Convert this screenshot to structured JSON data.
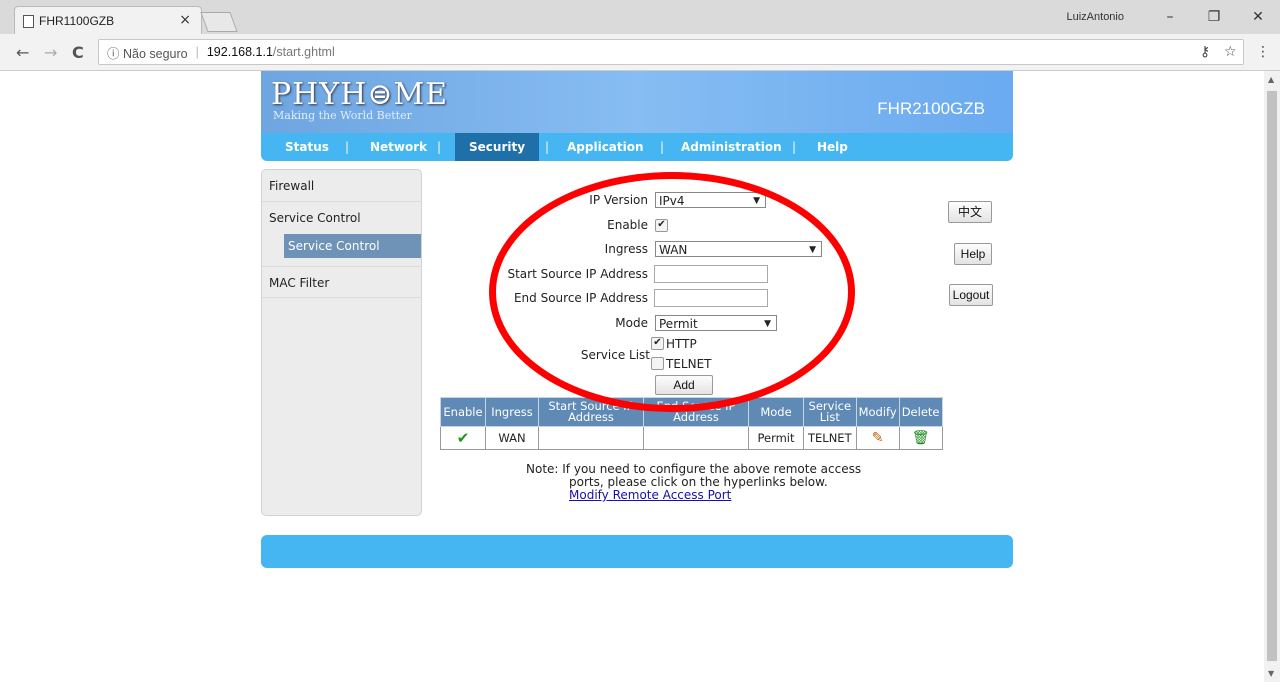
{
  "browser": {
    "tab_title": "FHR1100GZB",
    "tab_close": "×",
    "user": "LuizAntonio",
    "minimize": "–",
    "maximize": "❐",
    "close": "✕",
    "back": "←",
    "forward": "→",
    "reload": "C",
    "secure_label": "ⓘ Não seguro",
    "url_separator": "|",
    "url_host": "192.168.1.1",
    "url_path": "/start.ghtml",
    "key_icon": "⚷",
    "star_icon": "☆",
    "menu_icon": "⋮"
  },
  "header": {
    "logo": "PHYH⊜ME",
    "tagline": "Making the World Better",
    "model": "FHR2100GZB"
  },
  "menu": {
    "items": [
      "Status",
      "Network",
      "Security",
      "Application",
      "Administration",
      "Help"
    ],
    "separator": "|",
    "active": "Security"
  },
  "sidebar": {
    "firewall": "Firewall",
    "service_control": "Service Control",
    "service_control_sub": "Service Control",
    "mac_filter": "MAC Filter"
  },
  "form": {
    "ip_version_label": "IP Version",
    "ip_version_value": "IPv4",
    "enable_label": "Enable",
    "enable_checked": "✔",
    "ingress_label": "Ingress",
    "ingress_value": "WAN",
    "start_ip_label": "Start Source IP Address",
    "end_ip_label": "End Source IP Address",
    "mode_label": "Mode",
    "mode_value": "Permit",
    "service_list_label": "Service List",
    "services": [
      {
        "name": "HTTP",
        "checked": "✔"
      },
      {
        "name": "TELNET",
        "checked": ""
      }
    ],
    "add_button": "Add"
  },
  "side_buttons": {
    "lang": "中文",
    "help": "Help",
    "logout": "Logout"
  },
  "table": {
    "headers": [
      "Enable",
      "Ingress",
      "Start Source IP Address",
      "End Source IP Address",
      "Mode",
      "Service List",
      "Modify",
      "Delete"
    ],
    "rows": [
      {
        "enable": "✔",
        "ingress": "WAN",
        "start": "",
        "end": "",
        "mode": "Permit",
        "service": "TELNET",
        "modify": "✎",
        "delete": "🗑"
      }
    ]
  },
  "note": {
    "line1": "Note: If you need to configure the above remote access",
    "line2": "ports, please click on the hyperlinks below.",
    "link": "Modify Remote Access Port"
  },
  "colors": {
    "menu_bar": "#45b6f2",
    "active_menu": "#1f6fa8",
    "table_header": "#5f8ab5",
    "annotation": "#ff0000"
  }
}
